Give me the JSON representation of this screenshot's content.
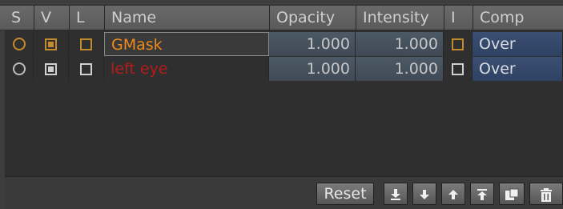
{
  "columns": {
    "s": "S",
    "v": "V",
    "l": "L",
    "name": "Name",
    "opacity": "Opacity",
    "intensity": "Intensity",
    "i": "I",
    "comp": "Comp"
  },
  "rows": [
    {
      "name": "GMask",
      "name_color": "#ef8a1c",
      "opacity": "1.000",
      "intensity": "1.000",
      "comp": "Over",
      "selected": true
    },
    {
      "name": "left eye",
      "name_color": "#b41c1c",
      "opacity": "1.000",
      "intensity": "1.000",
      "comp": "Over",
      "selected": false
    }
  ],
  "footer": {
    "reset_label": "Reset",
    "buttons": [
      {
        "icon": "move-to-bottom-icon"
      },
      {
        "icon": "move-down-icon"
      },
      {
        "icon": "move-up-icon"
      },
      {
        "icon": "move-to-top-icon"
      },
      {
        "icon": "duplicate-icon"
      },
      {
        "icon": "trash-icon"
      }
    ]
  },
  "colors": {
    "selection_accent": "#c58a2a",
    "comp_bg": "#344868",
    "value_bg": "#46525e"
  }
}
